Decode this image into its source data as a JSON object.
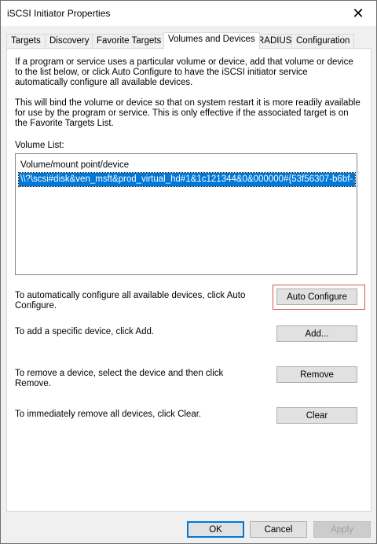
{
  "window": {
    "title": "iSCSI Initiator Properties",
    "close_glyph": "✕"
  },
  "tabs": [
    {
      "label": "Targets",
      "active": false
    },
    {
      "label": "Discovery",
      "active": false
    },
    {
      "label": "Favorite Targets",
      "active": false
    },
    {
      "label": "Volumes and Devices",
      "active": true
    },
    {
      "label": "RADIUS",
      "active": false
    },
    {
      "label": "Configuration",
      "active": false
    }
  ],
  "panel": {
    "intro_text": "If a program or service uses a particular volume or device, add that volume or device to the list below, or click Auto Configure to have the iSCSI initiator service automatically configure all available devices.",
    "bind_text": "This will bind the volume or device so that on system restart it is more readily available for use by the program or service.  This is only effective if the associated target is on the Favorite Targets List.",
    "volume_list_label": "Volume List:",
    "volume_list": {
      "column_header": "Volume/mount point/device",
      "rows": [
        "\\\\?\\scsi#disk&ven_msft&prod_virtual_hd#1&1c121344&0&000000#{53f56307-b6bf-..."
      ]
    },
    "auto_configure_text": "To automatically configure all available devices, click Auto Configure.",
    "add_text": "To add a specific device, click Add.",
    "remove_text": "To remove a device, select the device and then click Remove.",
    "clear_text": "To immediately remove all devices, click Clear.",
    "buttons": {
      "auto_configure": "Auto Configure",
      "add": "Add...",
      "remove": "Remove",
      "clear": "Clear"
    }
  },
  "footer": {
    "ok": "OK",
    "cancel": "Cancel",
    "apply": "Apply"
  },
  "colors": {
    "selection": "#0078d7",
    "highlight_box": "#d9534f"
  }
}
